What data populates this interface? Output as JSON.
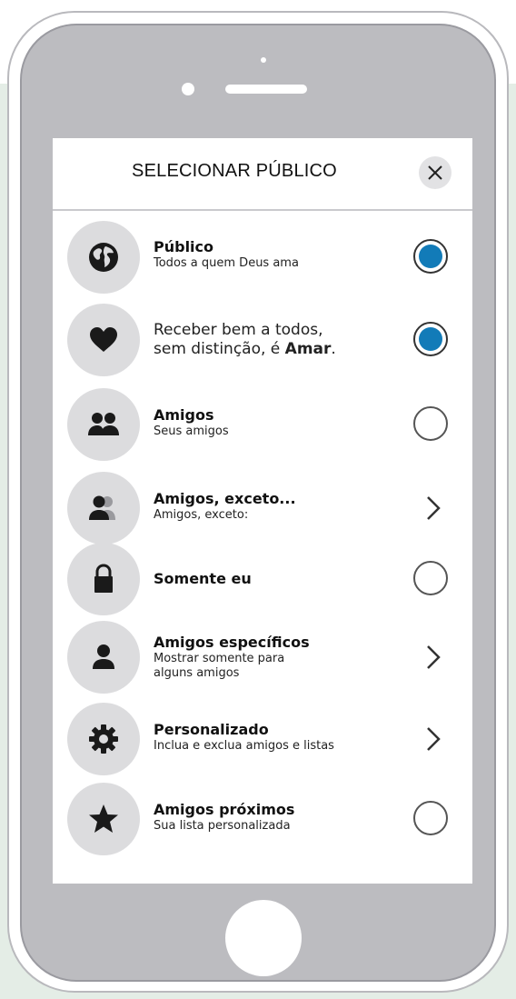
{
  "header": {
    "title": "SELECIONAR PÚBLICO",
    "close_icon": "close-icon"
  },
  "colors": {
    "accent": "#127bb8",
    "icon_circle": "#dcdcde",
    "phone_body": "#bcbcc0",
    "background_tint": "#e4ede6"
  },
  "items": [
    {
      "icon": "globe-icon",
      "primary": "Público",
      "secondary": "Todos a quem Deus ama",
      "control": "radio",
      "selected": true
    },
    {
      "icon": "heart-icon",
      "text_line1": "Receber bem a todos,",
      "text_line2_prefix": "sem distinção, é ",
      "text_line2_bold": "Amar",
      "text_line2_suffix": ".",
      "control": "radio",
      "selected": true
    },
    {
      "icon": "friends-icon",
      "primary": "Amigos",
      "secondary": "Seus amigos",
      "control": "radio",
      "selected": false
    },
    {
      "icon": "friends-except-icon",
      "primary": "Amigos, exceto...",
      "secondary": "Amigos, exceto:",
      "control": "chevron"
    },
    {
      "icon": "lock-icon",
      "primary": "Somente eu",
      "control": "radio",
      "selected": false
    },
    {
      "icon": "person-icon",
      "primary": "Amigos específicos",
      "secondary_line1": "Mostrar somente para",
      "secondary_line2": "alguns amigos",
      "control": "chevron"
    },
    {
      "icon": "gear-icon",
      "primary": "Personalizado",
      "secondary": "Inclua e exclua amigos e listas",
      "control": "chevron"
    },
    {
      "icon": "star-icon",
      "primary": "Amigos próximos",
      "secondary": "Sua lista personalizada",
      "control": "radio",
      "selected": false
    }
  ]
}
